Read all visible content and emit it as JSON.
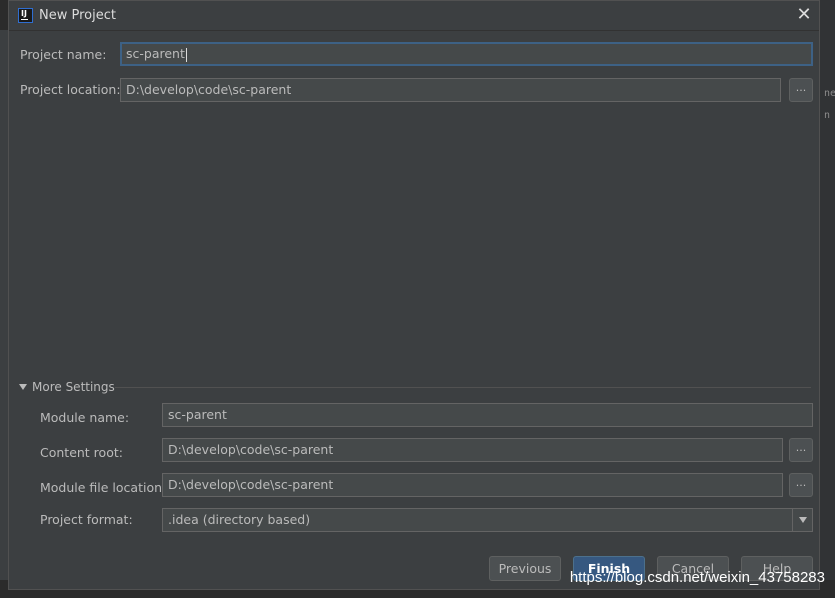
{
  "window": {
    "title": "New Project",
    "app_icon": "intellij-idea-icon",
    "close_icon": "close-icon"
  },
  "form": {
    "project_name": {
      "label": "Project name:",
      "value": "sc-parent"
    },
    "project_location": {
      "label": "Project location:",
      "value": "D:\\develop\\code\\sc-parent",
      "browse_label": "..."
    }
  },
  "more_settings": {
    "header": "More Settings",
    "module_name": {
      "label": "Module name:",
      "value": "sc-parent"
    },
    "content_root": {
      "label": "Content root:",
      "value": "D:\\develop\\code\\sc-parent",
      "browse_label": "..."
    },
    "module_file_location": {
      "label": "Module file location:",
      "value": "D:\\develop\\code\\sc-parent",
      "browse_label": "..."
    },
    "project_format": {
      "label": "Project format:",
      "value": ".idea (directory based)"
    }
  },
  "buttons": {
    "previous": "Previous",
    "finish": "Finish",
    "cancel": "Cancel",
    "help": "Help"
  },
  "watermark": "https://blog.csdn.net/weixin_43758283",
  "colors": {
    "dialog_bg": "#3c3f41",
    "field_bg": "#45494a",
    "focus_border": "#3d6185",
    "primary_button": "#365880"
  }
}
